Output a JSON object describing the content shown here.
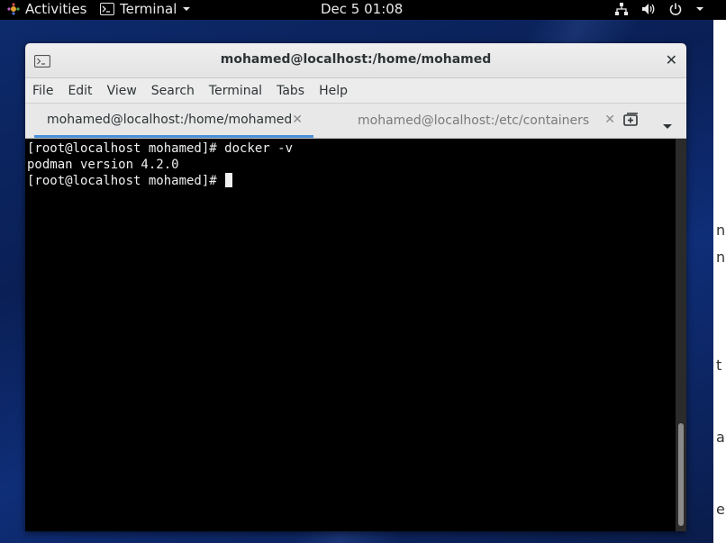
{
  "topbar": {
    "activities": "Activities",
    "app_name": "Terminal",
    "clock": "Dec 5  01:08"
  },
  "window": {
    "title": "mohamed@localhost:/home/mohamed",
    "menu": [
      "File",
      "Edit",
      "View",
      "Search",
      "Terminal",
      "Tabs",
      "Help"
    ],
    "tabs": [
      {
        "label": "mohamed@localhost:/home/mohamed",
        "active": true
      },
      {
        "label": "mohamed@localhost:/etc/containers",
        "active": false
      }
    ]
  },
  "terminal": {
    "lines": [
      "[root@localhost mohamed]# docker -v",
      "podman version 4.2.0",
      "[root@localhost mohamed]# "
    ]
  },
  "background_fragments": [
    "no",
    "n",
    "t",
    "a",
    "e"
  ],
  "colors": {
    "tab_underline": "#4a90d9",
    "terminal_bg": "#000000",
    "terminal_fg": "#f0f0f0"
  }
}
